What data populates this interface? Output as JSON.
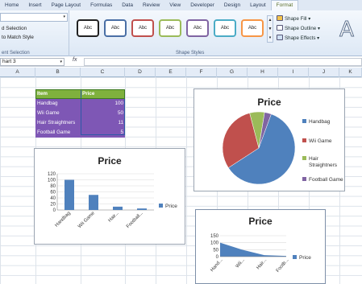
{
  "ribbon_tabs": [
    "Home",
    "Insert",
    "Page Layout",
    "Formulas",
    "Data",
    "Review",
    "View",
    "Developer",
    "Design",
    "Layout",
    "Format"
  ],
  "ribbon_left": {
    "selection_label": "d Selection",
    "match_style_label": "to Match Style",
    "group_caption": "ent Selection"
  },
  "shape_styles": {
    "swatch_label": "Abc",
    "group_caption": "Shape Styles",
    "fill_label": "Shape Fill",
    "outline_label": "Shape Outline",
    "effects_label": "Shape Effects",
    "wordart_glyph": "A",
    "swatch_colors": [
      "#222222",
      "#4a6fa5",
      "#c0504d",
      "#9bbb59",
      "#8064a2",
      "#4bacc6",
      "#f79646"
    ]
  },
  "formula_bar": {
    "name_box": "hart 3",
    "fx_label": "fx"
  },
  "columns": [
    "A",
    "B",
    "C",
    "D",
    "E",
    "F",
    "G",
    "H",
    "I",
    "J",
    "K"
  ],
  "table": {
    "headers": [
      "Item",
      "Price"
    ],
    "rows": [
      [
        "Handbag",
        "100"
      ],
      [
        "Wii Game",
        "50"
      ],
      [
        "Hair Straightners",
        "11"
      ],
      [
        "Football Game",
        "5"
      ]
    ]
  },
  "charts": {
    "pie": {
      "title": "Price"
    },
    "bar": {
      "title": "Price",
      "legend": "Price"
    },
    "area": {
      "title": "Price",
      "legend": "Price"
    }
  },
  "chart_data": [
    {
      "type": "pie",
      "title": "Price",
      "categories": [
        "Handbag",
        "Wii Game",
        "Hair Straightners",
        "Football Game"
      ],
      "values": [
        100,
        50,
        11,
        5
      ],
      "colors": [
        "#4f81bd",
        "#c0504d",
        "#9bbb59",
        "#8064a2"
      ],
      "legend": "right"
    },
    {
      "type": "bar",
      "title": "Price",
      "categories": [
        "Handbag",
        "Wii Game",
        "Hair Straightners",
        "Football Game"
      ],
      "tick_labels": [
        "Handbag",
        "Wii Game",
        "Hair...",
        "Football..."
      ],
      "series": [
        {
          "name": "Price",
          "values": [
            100,
            50,
            11,
            5
          ],
          "color": "#4f81bd"
        }
      ],
      "yticks": [
        0,
        20,
        40,
        60,
        80,
        100,
        120
      ],
      "ylim": [
        0,
        120
      ],
      "grid": true,
      "legend": "right"
    },
    {
      "type": "area",
      "title": "Price",
      "categories": [
        "Handbag",
        "Wii Game",
        "Hair Straightners",
        "Football Game"
      ],
      "tick_labels": [
        "Hand...",
        "Wii...",
        "Hair...",
        "Footb..."
      ],
      "series": [
        {
          "name": "Price",
          "values": [
            100,
            50,
            11,
            5
          ],
          "color": "#4f81bd"
        }
      ],
      "yticks": [
        0,
        50,
        100,
        150
      ],
      "ylim": [
        0,
        150
      ],
      "grid": true,
      "legend": "right"
    }
  ]
}
